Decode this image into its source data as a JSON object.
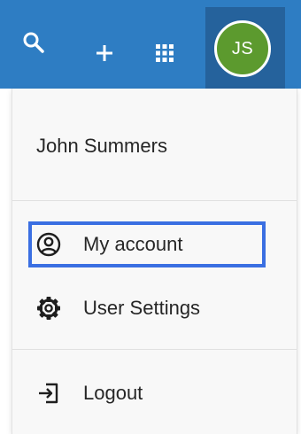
{
  "header": {
    "icons": [
      "search-icon",
      "plus-icon",
      "app-launcher-icon"
    ],
    "avatar_initials": "JS",
    "colors": {
      "bar": "#2e7dc3",
      "avatar_bg": "#5c9a2e",
      "avatar_active_bg": "#25629c"
    }
  },
  "menu": {
    "user_name": "John Summers",
    "items": [
      {
        "label": "My account",
        "icon": "account-circle-icon",
        "selected": true
      },
      {
        "label": "User Settings",
        "icon": "gear-icon",
        "selected": false
      },
      {
        "label": "Logout",
        "icon": "logout-icon",
        "selected": false
      }
    ],
    "colors": {
      "background": "#f8f8f8",
      "selection_border": "#3a6fe2"
    }
  }
}
